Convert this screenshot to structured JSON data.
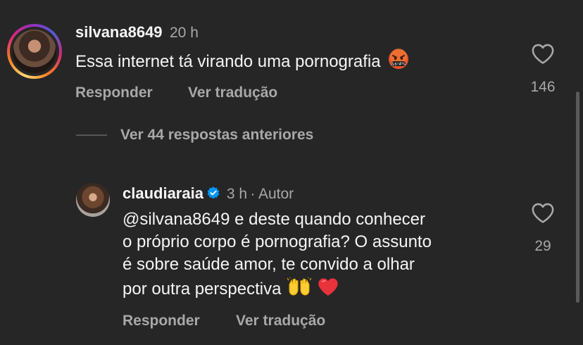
{
  "comment1": {
    "username": "silvana8649",
    "time": "20 h",
    "text": "Essa internet tá virando uma pornografia",
    "reply_label": "Responder",
    "translate_label": "Ver tradução",
    "likes": "146",
    "emoji": "angry-face-with-symbols-icon",
    "emoji_text": "&$!#%"
  },
  "replies": {
    "toggle_label": "Ver 44 respostas anteriores"
  },
  "comment2": {
    "username": "claudiaraia",
    "time": "3 h",
    "separator": "·",
    "author_label": "Autor",
    "text_line1": "@silvana8649 e deste quando conhecer",
    "text_line2": "o próprio corpo é pornografia? O assunto",
    "text_line3": "é sobre saúde amor, te convido a olhar",
    "text_line4": "por outra perspectiva",
    "reply_label": "Responder",
    "translate_label": "Ver tradução",
    "likes": "29",
    "emojis": [
      "raising-hands-icon",
      "red-heart-icon"
    ]
  },
  "colors": {
    "background": "#262626",
    "primary_text": "#f5f5f5",
    "secondary_text": "#a8a8a8",
    "verified_blue": "#0095f6",
    "heart_red": "#ed4956"
  }
}
